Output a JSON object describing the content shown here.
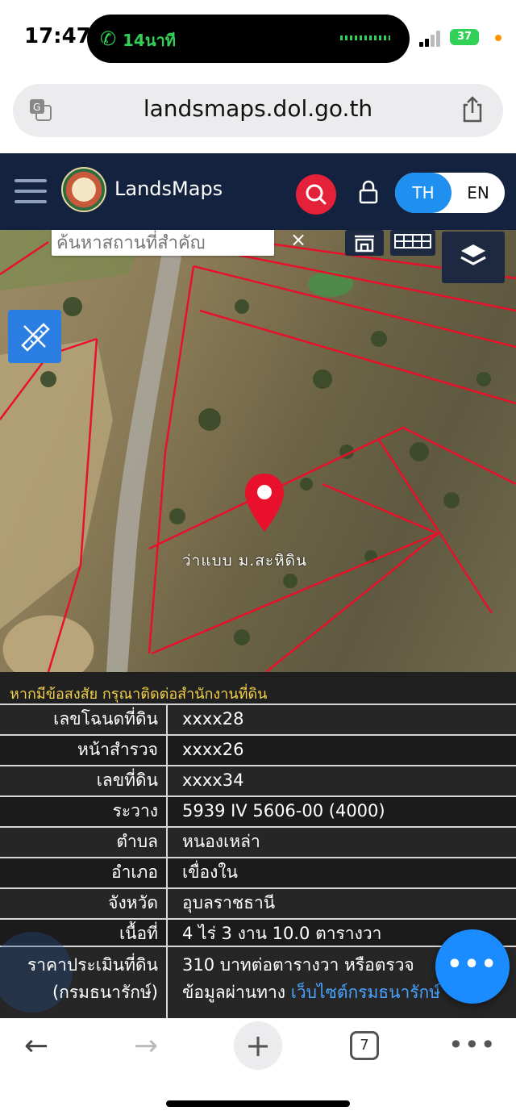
{
  "status": {
    "time": "17:47",
    "call_duration": "14นาที",
    "battery": "37"
  },
  "browser": {
    "url": "landsmaps.dol.go.th",
    "tab_count": "7"
  },
  "app": {
    "brand": "LandsMaps",
    "lang_th": "TH",
    "lang_en": "EN"
  },
  "map": {
    "search_placeholder": "ค้นหาสถานที่สำคัญ",
    "clear": "×",
    "parcel_label": "ว่าแบบ ม.สะหิดิน"
  },
  "info": {
    "notice": "หากมีข้อสงสัย กรุณาติดต่อสำนักงานที่ดิน",
    "rows": [
      {
        "label": "เลขโฉนดที่ดิน",
        "value": "xxxx28"
      },
      {
        "label": "หน้าสำรวจ",
        "value": "xxxx26"
      },
      {
        "label": "เลขที่ดิน",
        "value": "xxxx34"
      },
      {
        "label": "ระวาง",
        "value": "5939 IV 5606-00 (4000)"
      },
      {
        "label": "ตำบล",
        "value": "หนองเหล่า"
      },
      {
        "label": "อำเภอ",
        "value": "เขื่องใน"
      },
      {
        "label": "จังหวัด",
        "value": "อุบลราชธานี"
      },
      {
        "label": "เนื้อที่",
        "value": "4 ไร่ 3 งาน 10.0 ตารางวา"
      }
    ],
    "price_label_1": "ราคาประเมินที่ดิน",
    "price_label_2": "(กรมธนารักษ์)",
    "price_value_1": "310 บาทต่อตารางวา หรือตรวจ",
    "price_value_2_prefix": "ข้อมูลผ่านทาง ",
    "price_value_2_link": "เว็บไซต์กรมธนารักษ์"
  },
  "fab_label": "•••",
  "icons": [
    "phone-icon",
    "signal-icon",
    "battery-icon",
    "translate-icon",
    "share-icon",
    "menu-icon",
    "logo-emblem",
    "search-icon",
    "lock-icon",
    "home-icon",
    "grid-icon",
    "layers-icon",
    "ruler-icon",
    "location-pin-icon",
    "back-icon",
    "forward-icon",
    "plus-icon",
    "tabs-icon",
    "more-icon"
  ],
  "colors": {
    "header_bg": "#13223f",
    "accent_blue": "#1f8ff0",
    "search_red": "#e5213a",
    "parcel_line": "#e8102a",
    "notice_yellow": "#f2d14a"
  }
}
